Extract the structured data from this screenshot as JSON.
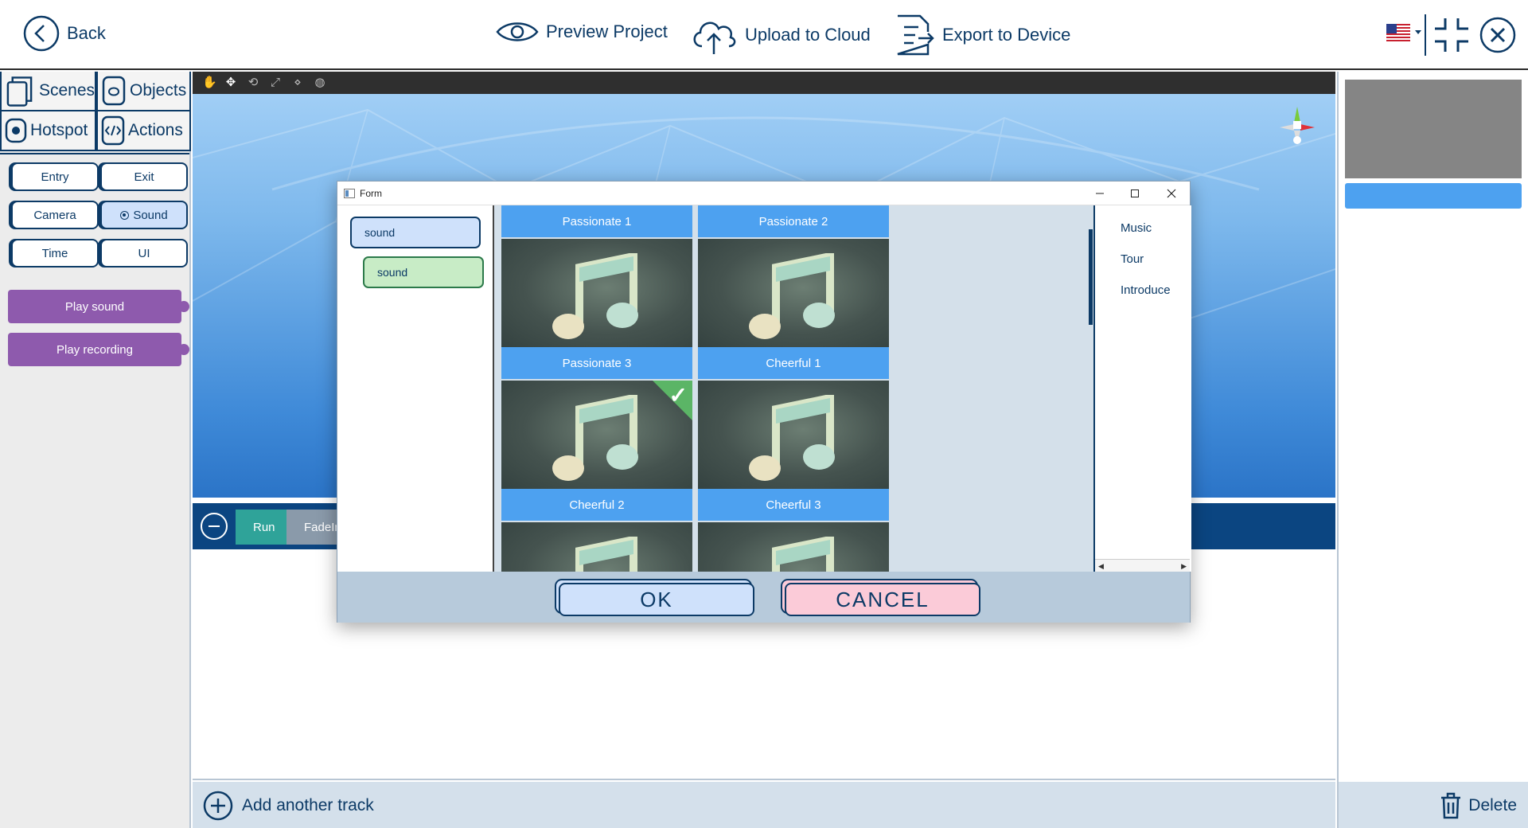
{
  "topbar": {
    "back_label": "Back",
    "preview_label": "Preview Project",
    "upload_label": "Upload to Cloud",
    "export_label": "Export to Device",
    "language_flag": "us-flag-icon"
  },
  "left_panel": {
    "tabs": [
      {
        "label": "Scenes",
        "icon": "scenes-icon"
      },
      {
        "label": "Objects",
        "icon": "objects-icon"
      },
      {
        "label": "Hotspot",
        "icon": "eye-icon"
      },
      {
        "label": "Actions",
        "icon": "code-icon"
      }
    ],
    "categories": [
      {
        "label": "Entry",
        "selected": false
      },
      {
        "label": "Exit",
        "selected": false
      },
      {
        "label": "Camera",
        "selected": false
      },
      {
        "label": "Sound",
        "selected": true
      },
      {
        "label": "Time",
        "selected": false
      },
      {
        "label": "UI",
        "selected": false
      }
    ],
    "actions": [
      {
        "label": "Play sound"
      },
      {
        "label": "Play recording"
      }
    ]
  },
  "timeline": {
    "run_label": "Run",
    "fade_label": "FadeIn"
  },
  "bottom": {
    "add_track_label": "Add another track",
    "delete_label": "Delete"
  },
  "dialog": {
    "title": "Form",
    "tree": [
      {
        "label": "sound",
        "level": 0
      },
      {
        "label": "sound",
        "level": 1
      }
    ],
    "tiles": [
      {
        "label": "Passionate 1",
        "selected": false
      },
      {
        "label": "Passionate 2",
        "selected": false
      },
      {
        "label": "Passionate 3",
        "selected": false
      },
      {
        "label": "Cheerful 1",
        "selected": false
      },
      {
        "label": "Cheerful 2",
        "selected": true
      },
      {
        "label": "Cheerful 3",
        "selected": false
      }
    ],
    "categories": [
      "Music",
      "Tour",
      "Introduce"
    ],
    "ok_label": "OK",
    "cancel_label": "CANCEL"
  },
  "colors": {
    "navy": "#0c3a66",
    "tile_caption": "#4da1f0",
    "action_purple": "#8e5aad",
    "run_teal": "#2fa399",
    "check_green": "#5bb566"
  }
}
